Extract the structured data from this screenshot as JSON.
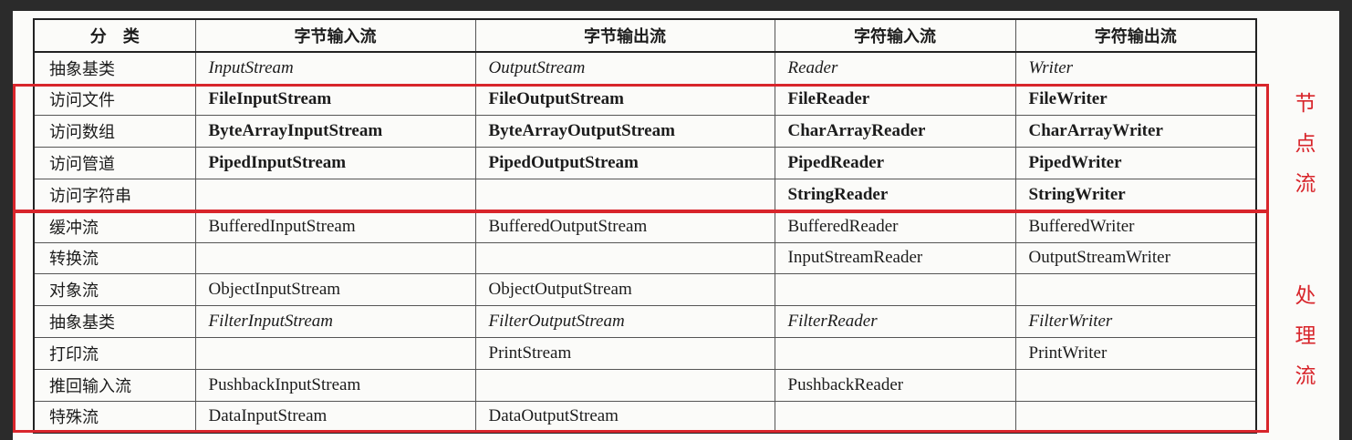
{
  "table": {
    "headers": [
      "分　类",
      "字节输入流",
      "字节输出流",
      "字符输入流",
      "字符输出流"
    ],
    "rows": [
      {
        "category": "抽象基类",
        "cells": [
          "InputStream",
          "OutputStream",
          "Reader",
          "Writer"
        ],
        "style": "italic"
      },
      {
        "category": "访问文件",
        "cells": [
          "FileInputStream",
          "FileOutputStream",
          "FileReader",
          "FileWriter"
        ],
        "style": "bold"
      },
      {
        "category": "访问数组",
        "cells": [
          "ByteArrayInputStream",
          "ByteArrayOutputStream",
          "CharArrayReader",
          "CharArrayWriter"
        ],
        "style": "bold"
      },
      {
        "category": "访问管道",
        "cells": [
          "PipedInputStream",
          "PipedOutputStream",
          "PipedReader",
          "PipedWriter"
        ],
        "style": "bold"
      },
      {
        "category": "访问字符串",
        "cells": [
          "",
          "",
          "StringReader",
          "StringWriter"
        ],
        "style": "bold"
      },
      {
        "category": "缓冲流",
        "cells": [
          "BufferedInputStream",
          "BufferedOutputStream",
          "BufferedReader",
          "BufferedWriter"
        ],
        "style": "normal"
      },
      {
        "category": "转换流",
        "cells": [
          "",
          "",
          "InputStreamReader",
          "OutputStreamWriter"
        ],
        "style": "normal"
      },
      {
        "category": "对象流",
        "cells": [
          "ObjectInputStream",
          "ObjectOutputStream",
          "",
          ""
        ],
        "style": "normal"
      },
      {
        "category": "抽象基类",
        "cells": [
          "FilterInputStream",
          "FilterOutputStream",
          "FilterReader",
          "FilterWriter"
        ],
        "style": "italic"
      },
      {
        "category": "打印流",
        "cells": [
          "",
          "PrintStream",
          "",
          "PrintWriter"
        ],
        "style": "normal"
      },
      {
        "category": "推回输入流",
        "cells": [
          "PushbackInputStream",
          "",
          "PushbackReader",
          ""
        ],
        "style": "normal"
      },
      {
        "category": "特殊流",
        "cells": [
          "DataInputStream",
          "DataOutputStream",
          "",
          ""
        ],
        "style": "normal"
      }
    ]
  },
  "annotations": {
    "node_stream": [
      "节",
      "点",
      "流"
    ],
    "processing_stream": [
      "处",
      "理",
      "流"
    ],
    "color": "#d8252b"
  }
}
